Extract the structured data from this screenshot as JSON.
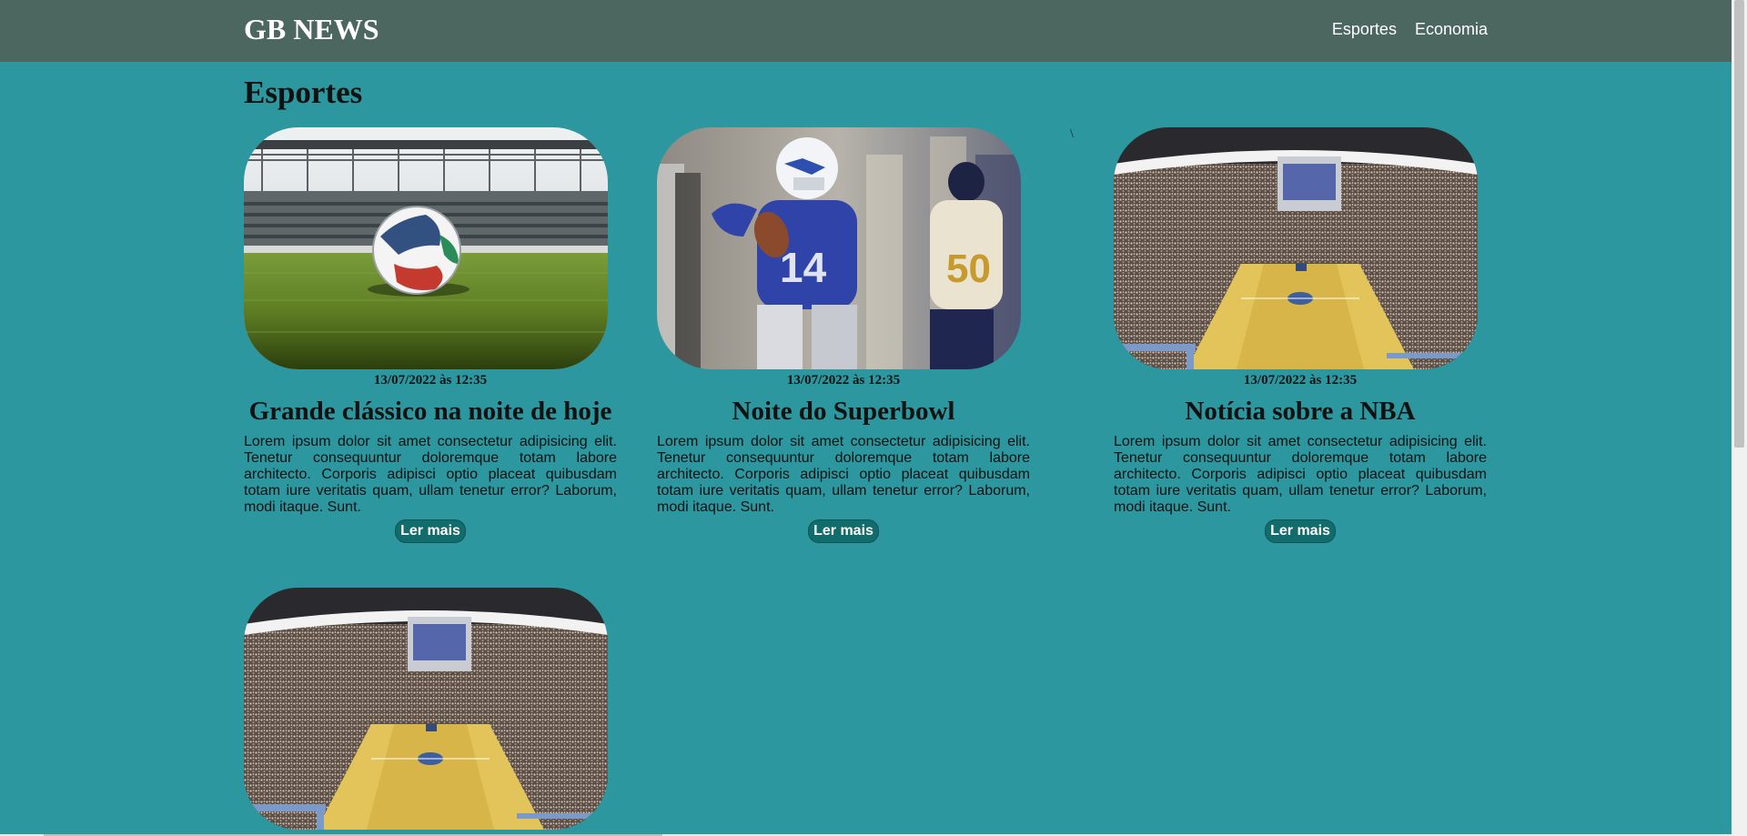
{
  "header": {
    "brand": "GB NEWS",
    "nav": [
      {
        "label": "Esportes"
      },
      {
        "label": "Economia"
      }
    ]
  },
  "section": {
    "title": "Esportes",
    "stray_char": "\\"
  },
  "cards": [
    {
      "image": "soccer-ball-stadium",
      "date": "13/07/2022 às 12:35",
      "title": "Grande clássico na noite de hoje",
      "text": "Lorem ipsum dolor sit amet consectetur adipisicing elit. Tenetur consequuntur doloremque totam labore architecto. Corporis adipisci optio placeat quibusdam totam iure veritatis quam, ullam tenetur error? Laborum, modi itaque. Sunt.",
      "button": "Ler mais"
    },
    {
      "image": "american-football-quarterback",
      "date": "13/07/2022 às 12:35",
      "title": "Noite do Superbowl",
      "text": "Lorem ipsum dolor sit amet consectetur adipisicing elit. Tenetur consequuntur doloremque totam labore architecto. Corporis adipisci optio placeat quibusdam totam iure veritatis quam, ullam tenetur error? Laborum, modi itaque. Sunt.",
      "button": "Ler mais"
    },
    {
      "image": "basketball-arena",
      "date": "13/07/2022 às 12:35",
      "title": "Notícia sobre a NBA",
      "text": "Lorem ipsum dolor sit amet consectetur adipisicing elit. Tenetur consequuntur doloremque totam labore architecto. Corporis adipisci optio placeat quibusdam totam iure veritatis quam, ullam tenetur error? Laborum, modi itaque. Sunt.",
      "button": "Ler mais"
    },
    {
      "image": "basketball-arena"
    }
  ],
  "colors": {
    "page_bg": "#2c979f",
    "navbar_bg": "#4c675f",
    "button_bg": "#126c6c"
  }
}
